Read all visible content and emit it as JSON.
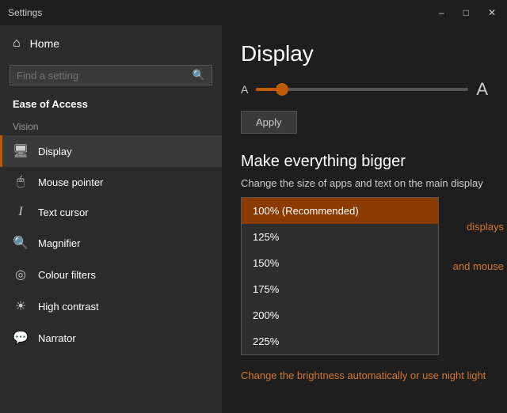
{
  "titlebar": {
    "title": "Settings",
    "minimize": "–",
    "maximize": "□",
    "close": "✕"
  },
  "sidebar": {
    "home_label": "Home",
    "search_placeholder": "Find a setting",
    "ease_access_label": "Ease of Access",
    "vision_label": "Vision",
    "nav_items": [
      {
        "id": "display",
        "label": "Display",
        "icon": "🖥",
        "active": true
      },
      {
        "id": "mouse-pointer",
        "label": "Mouse pointer",
        "icon": "🖱",
        "active": false
      },
      {
        "id": "text-cursor",
        "label": "Text cursor",
        "icon": "𝐈",
        "active": false
      },
      {
        "id": "magnifier",
        "label": "Magnifier",
        "icon": "🔍",
        "active": false
      },
      {
        "id": "colour-filters",
        "label": "Colour filters",
        "icon": "◎",
        "active": false
      },
      {
        "id": "high-contrast",
        "label": "High contrast",
        "icon": "☀",
        "active": false
      },
      {
        "id": "narrator",
        "label": "Narrator",
        "icon": "💬",
        "active": false
      }
    ]
  },
  "main": {
    "page_title": "Display",
    "brightness_a_small": "A",
    "brightness_a_large": "A",
    "apply_label": "Apply",
    "section_title": "Make everything bigger",
    "section_desc": "Change the size of apps and text on the main display",
    "dropdown_options": [
      {
        "value": "100",
        "label": "100% (Recommended)",
        "selected": true
      },
      {
        "value": "125",
        "label": "125%",
        "selected": false
      },
      {
        "value": "150",
        "label": "150%",
        "selected": false
      },
      {
        "value": "175",
        "label": "175%",
        "selected": false
      },
      {
        "value": "200",
        "label": "200%",
        "selected": false
      },
      {
        "value": "225",
        "label": "225%",
        "selected": false
      }
    ],
    "auto_brightness_text": "Change the brightness automatically or use night light",
    "partial_text_1": "displays",
    "partial_text_2": "and mouse"
  }
}
